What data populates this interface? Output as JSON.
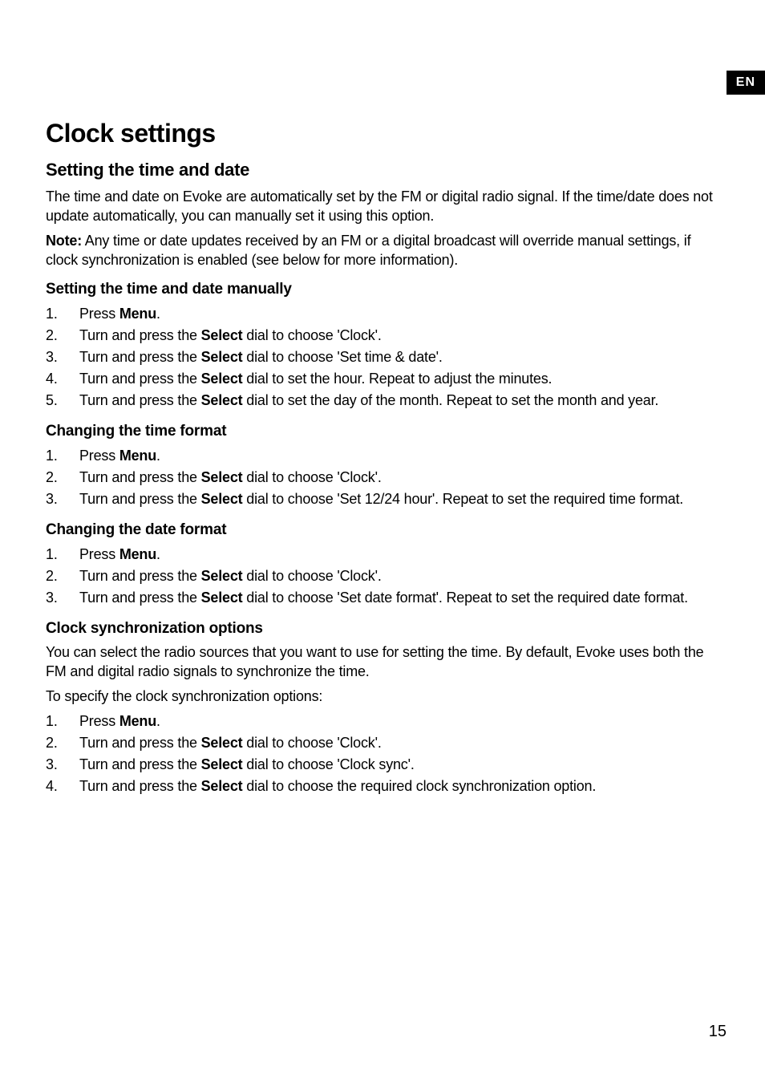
{
  "lang_tab": "EN",
  "page_number": "15",
  "title": "Clock settings",
  "section1": {
    "heading": "Setting the time and date",
    "p1": "The time and date on Evoke are automatically set by the FM or digital radio signal. If the time/date does not update automatically, you can manually set it using this option.",
    "note_label": "Note:",
    "note_text": " Any time or date updates received by an FM or a digital broadcast will override manual settings, if clock synchronization is enabled (see below for more information)."
  },
  "subsection1": {
    "heading": "Setting the time and date manually",
    "items": {
      "i1_pre": "Press ",
      "i1_bold": "Menu",
      "i1_post": ".",
      "i2_pre": "Turn and press the ",
      "i2_bold": "Select",
      "i2_post": " dial to choose 'Clock'.",
      "i3_pre": "Turn and press the ",
      "i3_bold": "Select",
      "i3_post": " dial to choose 'Set time & date'.",
      "i4_pre": "Turn and press the ",
      "i4_bold": "Select",
      "i4_post": " dial to set the hour. Repeat to adjust the minutes.",
      "i5_pre": "Turn and press the ",
      "i5_bold": "Select",
      "i5_post": " dial to set the day of the month. Repeat to set the month and year."
    }
  },
  "subsection2": {
    "heading": "Changing the time format",
    "items": {
      "i1_pre": "Press ",
      "i1_bold": "Menu",
      "i1_post": ".",
      "i2_pre": "Turn and press the ",
      "i2_bold": "Select",
      "i2_post": " dial to choose 'Clock'.",
      "i3_pre": "Turn and press the ",
      "i3_bold": "Select",
      "i3_post": " dial to choose 'Set 12/24 hour'. Repeat to set the required time format."
    }
  },
  "subsection3": {
    "heading": "Changing the date format",
    "items": {
      "i1_pre": "Press ",
      "i1_bold": "Menu",
      "i1_post": ".",
      "i2_pre": "Turn and press the ",
      "i2_bold": "Select",
      "i2_post": " dial to choose 'Clock'.",
      "i3_pre": "Turn and press the ",
      "i3_bold": "Select",
      "i3_post": " dial to choose 'Set date format'. Repeat to set the required date format."
    }
  },
  "subsection4": {
    "heading": "Clock synchronization options",
    "p1": "You can select the radio sources that you want to use for setting the time. By default, Evoke uses both the FM and digital radio signals to synchronize the time.",
    "p2": "To specify the clock synchronization options:",
    "items": {
      "i1_pre": "Press ",
      "i1_bold": "Menu",
      "i1_post": ".",
      "i2_pre": "Turn and press the ",
      "i2_bold": "Select",
      "i2_post": " dial to choose 'Clock'.",
      "i3_pre": "Turn and press the ",
      "i3_bold": "Select",
      "i3_post": " dial to choose 'Clock sync'.",
      "i4_pre": "Turn and press the ",
      "i4_bold": "Select",
      "i4_post": " dial to choose the required clock synchronization option."
    }
  }
}
